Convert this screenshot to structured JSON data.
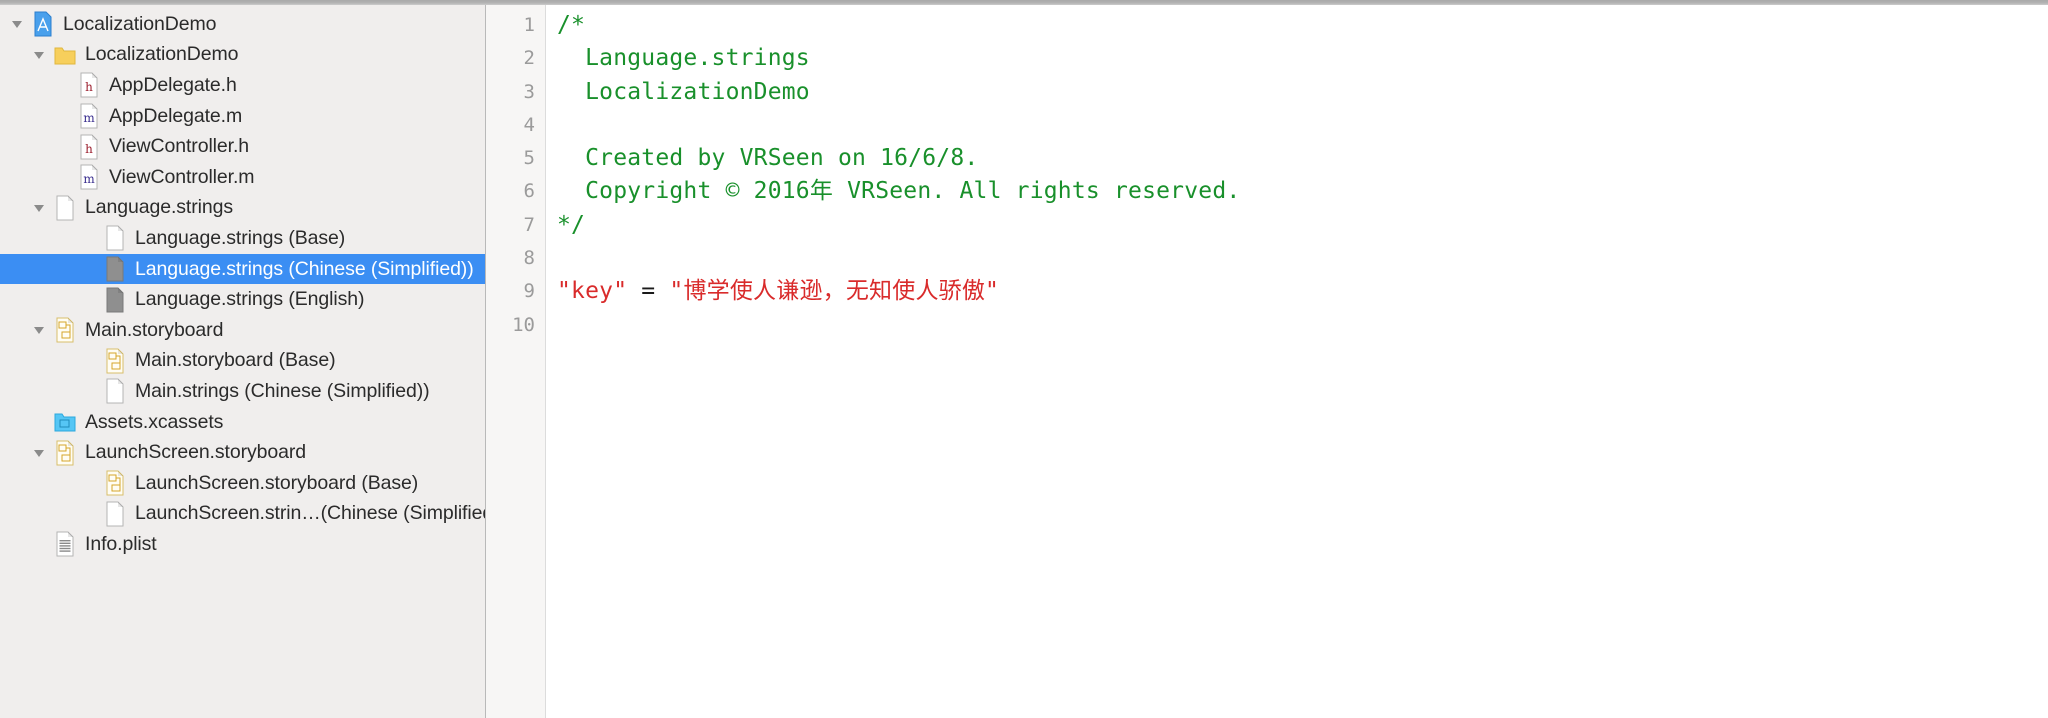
{
  "window": {
    "app": "Xcode",
    "project_title": "LocalizationDemo"
  },
  "navigator": {
    "rows": [
      {
        "label": "LocalizationDemo",
        "icon": "xcode-project-icon",
        "indent": 0,
        "twisty": "down",
        "selected": false
      },
      {
        "label": "LocalizationDemo",
        "icon": "folder-icon",
        "indent": 1,
        "twisty": "down",
        "selected": false
      },
      {
        "label": "AppDelegate.h",
        "icon": "header-file-icon",
        "indent": 2,
        "twisty": "none",
        "selected": false
      },
      {
        "label": "AppDelegate.m",
        "icon": "implementation-file-icon",
        "indent": 2,
        "twisty": "none",
        "selected": false
      },
      {
        "label": "ViewController.h",
        "icon": "header-file-icon",
        "indent": 2,
        "twisty": "none",
        "selected": false
      },
      {
        "label": "ViewController.m",
        "icon": "implementation-file-icon",
        "indent": 2,
        "twisty": "none",
        "selected": false
      },
      {
        "label": "Language.strings",
        "icon": "blank-file-icon",
        "indent": 1,
        "twisty": "down",
        "selected": false
      },
      {
        "label": "Language.strings (Base)",
        "icon": "blank-file-icon",
        "indent": 3,
        "twisty": "none",
        "selected": false
      },
      {
        "label": "Language.strings (Chinese (Simplified))",
        "icon": "strings-file-icon",
        "indent": 3,
        "twisty": "none",
        "selected": true
      },
      {
        "label": "Language.strings (English)",
        "icon": "strings-file-icon",
        "indent": 3,
        "twisty": "none",
        "selected": false
      },
      {
        "label": "Main.storyboard",
        "icon": "storyboard-icon",
        "indent": 1,
        "twisty": "down",
        "selected": false
      },
      {
        "label": "Main.storyboard (Base)",
        "icon": "storyboard-icon",
        "indent": 3,
        "twisty": "none",
        "selected": false
      },
      {
        "label": "Main.strings (Chinese (Simplified))",
        "icon": "blank-file-icon",
        "indent": 3,
        "twisty": "none",
        "selected": false
      },
      {
        "label": "Assets.xcassets",
        "icon": "assets-catalog-icon",
        "indent": 1,
        "twisty": "none",
        "selected": false
      },
      {
        "label": "LaunchScreen.storyboard",
        "icon": "storyboard-icon",
        "indent": 1,
        "twisty": "down",
        "selected": false
      },
      {
        "label": "LaunchScreen.storyboard (Base)",
        "icon": "storyboard-icon",
        "indent": 3,
        "twisty": "none",
        "selected": false
      },
      {
        "label": "LaunchScreen.strin…(Chinese (Simplified))",
        "icon": "blank-file-icon",
        "indent": 3,
        "twisty": "none",
        "selected": false
      },
      {
        "label": "Info.plist",
        "icon": "plist-file-icon",
        "indent": 1,
        "twisty": "none",
        "selected": false
      }
    ]
  },
  "editor": {
    "line_numbers": [
      "1",
      "2",
      "3",
      "4",
      "5",
      "6",
      "7",
      "8",
      "9",
      "10"
    ],
    "lines": [
      {
        "n": "1",
        "segments": [
          {
            "text": "/*",
            "type": "comment"
          }
        ]
      },
      {
        "n": "2",
        "segments": [
          {
            "text": "  Language.strings",
            "type": "comment"
          }
        ]
      },
      {
        "n": "3",
        "segments": [
          {
            "text": "  LocalizationDemo",
            "type": "comment"
          }
        ]
      },
      {
        "n": "4",
        "segments": [
          {
            "text": "",
            "type": "comment"
          }
        ]
      },
      {
        "n": "5",
        "segments": [
          {
            "text": "  Created by VRSeen on 16/6/8.",
            "type": "comment"
          }
        ]
      },
      {
        "n": "6",
        "segments": [
          {
            "text": "  Copyright © 2016年 VRSeen. All rights reserved.",
            "type": "comment"
          }
        ]
      },
      {
        "n": "7",
        "segments": [
          {
            "text": "*/",
            "type": "comment"
          }
        ]
      },
      {
        "n": "8",
        "segments": [
          {
            "text": "",
            "type": "plain"
          }
        ]
      },
      {
        "n": "9",
        "segments": [
          {
            "text": "\"key\"",
            "type": "string"
          },
          {
            "text": " = ",
            "type": "plain"
          },
          {
            "text": "\"博学使人谦逊，无知使人骄傲\"",
            "type": "string"
          }
        ]
      },
      {
        "n": "10",
        "segments": [
          {
            "text": "",
            "type": "plain"
          }
        ]
      }
    ]
  },
  "colors": {
    "selection_blue": "#3b8ef3",
    "comment_green": "#19902b",
    "string_red": "#d92b2b",
    "sidebar_bg": "#f0eeed",
    "gutter_bg": "#f7f6f5",
    "editor_bg": "#ffffff"
  }
}
